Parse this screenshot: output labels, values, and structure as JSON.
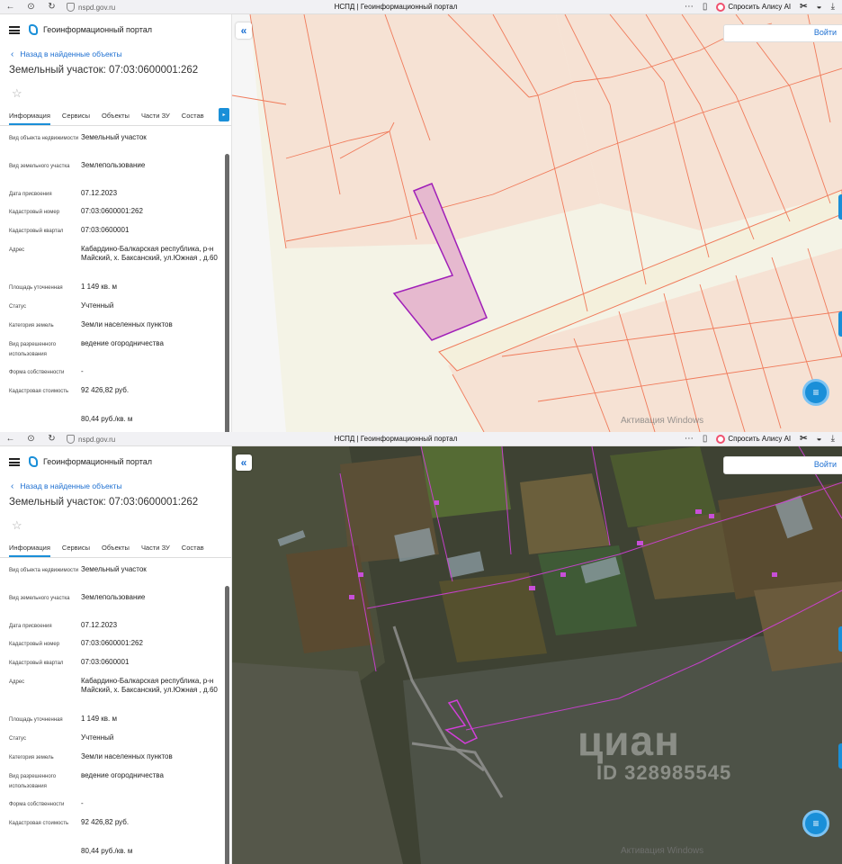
{
  "browser": {
    "url": "nspd.gov.ru",
    "page_title": "НСПД | Геоинформационный портал",
    "alisa_label": "Спросить Алису AI"
  },
  "panel": {
    "app_title": "Геоинформационный портал",
    "back_link": "Назад в найденные объекты",
    "object_title": "Земельный участок: 07:03:0600001:262",
    "tabs": [
      "Информация",
      "Сервисы",
      "Объекты",
      "Части ЗУ",
      "Состав"
    ],
    "rows": [
      {
        "key": "Вид объекта недвижимости",
        "value": "Земельный участок"
      },
      {
        "key": "Вид земельного участка",
        "value": "Землепользование"
      },
      {
        "key": "Дата присвоения",
        "value": "07.12.2023"
      },
      {
        "key": "Кадастровый номер",
        "value": "07:03:0600001:262"
      },
      {
        "key": "Кадастровый квартал",
        "value": "07:03:0600001"
      },
      {
        "key": "Адрес",
        "value": "Кабардино-Балкарская республика, р-н Майский, х. Баксанский, ул.Южная , д.60"
      },
      {
        "key": "Площадь уточненная",
        "value": "1 149 кв. м"
      },
      {
        "key": "Статус",
        "value": "Учтенный"
      },
      {
        "key": "Категория земель",
        "value": "Земли населенных пунктов"
      },
      {
        "key": "Вид разрешенного использования",
        "value": "ведение огородничества"
      },
      {
        "key": "Форма собственности",
        "value": "-"
      },
      {
        "key": "Кадастровая стоимость",
        "value": "92 426,82 руб."
      },
      {
        "key": "",
        "value": "80,44 руб./кв. м"
      }
    ]
  },
  "map": {
    "login_label": "Войти",
    "windows_activation": "Активация Windows",
    "watermark_brand": "циан",
    "watermark_id": "ID 328985545"
  },
  "icons": {
    "collapse": "double-chevron-left-icon",
    "chat": "chat-icon",
    "star": "star-icon"
  },
  "colors": {
    "accent": "#1a8fd8",
    "parcel_outline": "#a01fb8",
    "boundary_lines": "#f07a5a"
  }
}
